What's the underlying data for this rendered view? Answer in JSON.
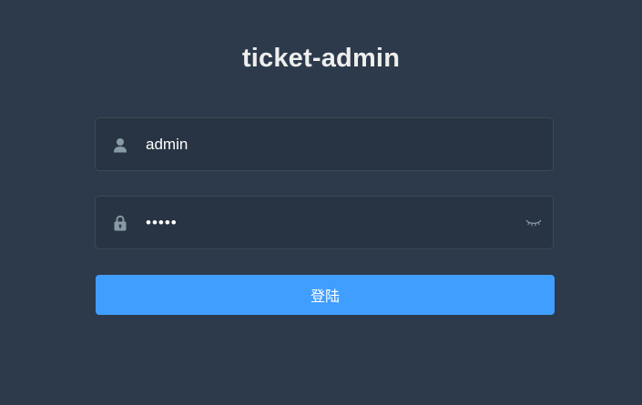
{
  "login": {
    "title": "ticket-admin",
    "username": {
      "value": "admin",
      "placeholder": "",
      "icon": "user-icon"
    },
    "password": {
      "value": "admin",
      "placeholder": "",
      "icon": "lock-icon",
      "toggle_icon": "eye-closed-icon"
    },
    "submit_label": "登陆"
  },
  "colors": {
    "background": "#2d3a4b",
    "title": "#eeeeee",
    "icon": "#889aa4",
    "button": "#409eff"
  }
}
